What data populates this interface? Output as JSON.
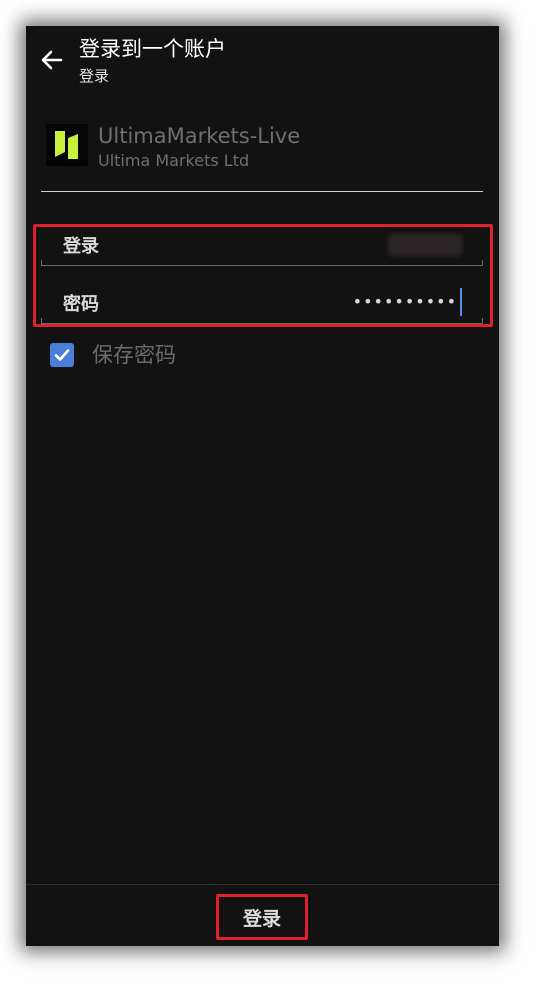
{
  "header": {
    "back_icon": "arrow-left-icon",
    "title": "登录到一个账户",
    "subtitle": "登录"
  },
  "server": {
    "logo_icon": "ultima-markets-logo",
    "name": "UltimaMarkets-Live",
    "company": "Ultima Markets Ltd"
  },
  "form": {
    "login_label": "登录",
    "password_label": "密码",
    "password_value": "••••••••••",
    "save_password_label": "保存密码",
    "save_password_checked": true
  },
  "footer": {
    "submit_label": "登录"
  },
  "colors": {
    "background": "#121212",
    "accent": "#4a7ed9",
    "logo_green": "#c9f03a",
    "highlight": "#e0202c"
  }
}
